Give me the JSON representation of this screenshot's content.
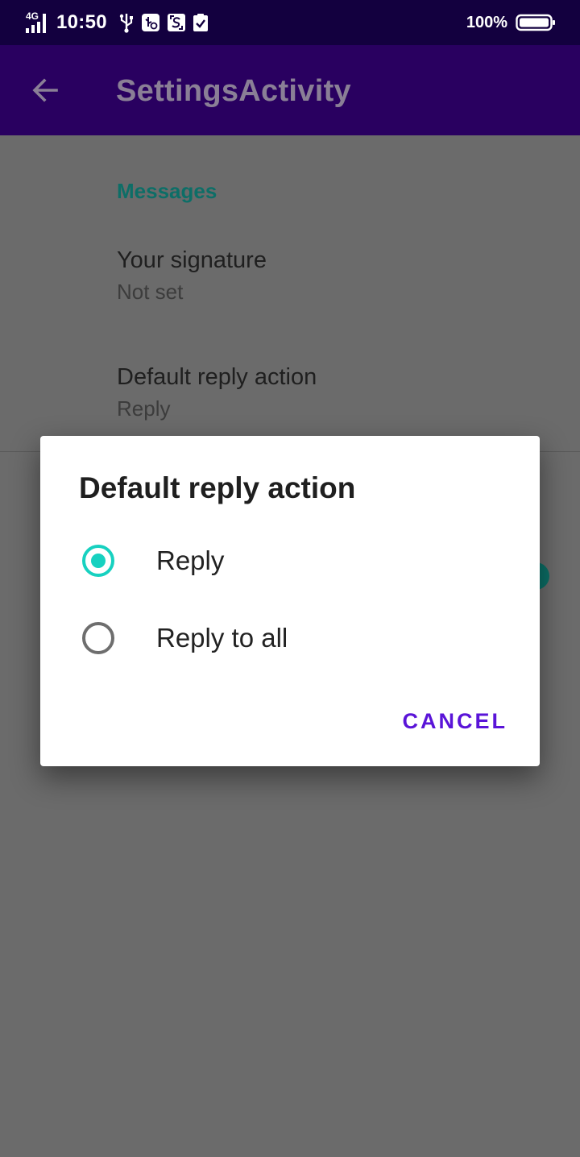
{
  "status_bar": {
    "network": "4G",
    "time": "10:50",
    "battery": "100%",
    "icons": [
      "signal-icon",
      "usb-icon",
      "usb-debug-icon",
      "screenshot-icon",
      "clipboard-check-icon",
      "battery-icon"
    ]
  },
  "app_bar": {
    "title": "SettingsActivity",
    "back_icon": "arrow-back-icon"
  },
  "settings": {
    "category": "Messages",
    "items": [
      {
        "title": "Your signature",
        "summary": "Not set"
      },
      {
        "title": "Default reply action",
        "summary": "Reply"
      }
    ]
  },
  "dialog": {
    "title": "Default reply action",
    "options": [
      {
        "label": "Reply",
        "selected": true
      },
      {
        "label": "Reply to all",
        "selected": false
      }
    ],
    "cancel_label": "CANCEL"
  },
  "colors": {
    "status_bar": "#13003f",
    "app_bar": "#290060",
    "accent": "#17d1c0",
    "category": "#0d6e67",
    "button": "#5a14d8",
    "scrim_background": "#6b6b6b"
  }
}
